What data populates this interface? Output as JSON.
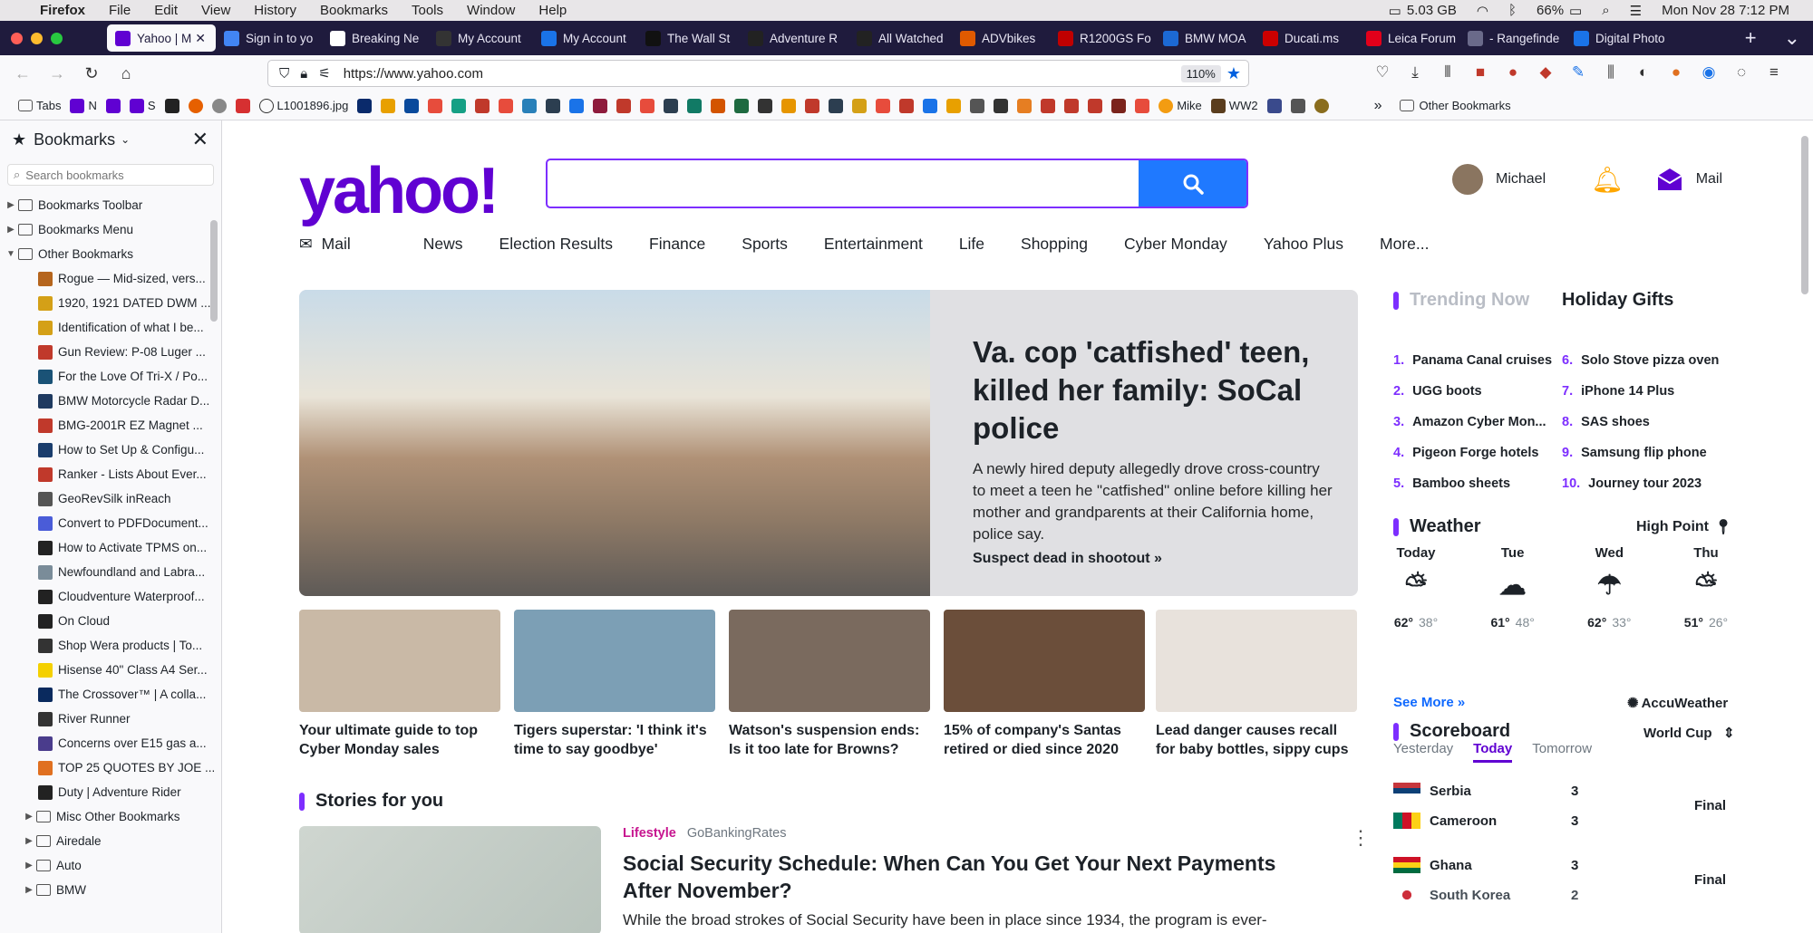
{
  "menubar": {
    "app": "Firefox",
    "items": [
      "File",
      "Edit",
      "View",
      "History",
      "Bookmarks",
      "Tools",
      "Window",
      "Help"
    ],
    "memory": "5.03 GB",
    "battery": "66%",
    "datetime": "Mon Nov 28  7:12 PM"
  },
  "tabs": [
    {
      "label": "Yahoo | M",
      "color": "#6001d2"
    },
    {
      "label": "Sign in to yo",
      "color": "#4285f4"
    },
    {
      "label": "Breaking Ne",
      "color": "#ffffff"
    },
    {
      "label": "My Account",
      "color": "#333333"
    },
    {
      "label": "My Account",
      "color": "#1a73e8"
    },
    {
      "label": "The Wall St",
      "color": "#111111"
    },
    {
      "label": "Adventure R",
      "color": "#222222"
    },
    {
      "label": "All Watched",
      "color": "#222222"
    },
    {
      "label": "ADVbikes",
      "color": "#e05a00"
    },
    {
      "label": "R1200GS Fo",
      "color": "#c00000"
    },
    {
      "label": "BMW MOA",
      "color": "#1c69d4"
    },
    {
      "label": "Ducati.ms",
      "color": "#cc0000"
    },
    {
      "label": "Leica Forum",
      "color": "#e2001a"
    },
    {
      "label": "- Rangefinde",
      "color": "#6a6a8a"
    },
    {
      "label": "Digital Photo",
      "color": "#1a73e8"
    }
  ],
  "navbar": {
    "url": "https://www.yahoo.com",
    "zoom": "110%"
  },
  "bookmarks_bar": {
    "items": [
      "Tabs",
      "N",
      "S",
      "L1001896.jpg",
      "Mike",
      "WW2"
    ],
    "overflow_label": "Other Bookmarks"
  },
  "sidebar": {
    "title": "Bookmarks",
    "search_placeholder": "Search bookmarks",
    "top_folders": [
      "Bookmarks Toolbar",
      "Bookmarks Menu",
      "Other Bookmarks"
    ],
    "items": [
      {
        "label": "Rogue — Mid-sized, vers...",
        "color": "#b5651d"
      },
      {
        "label": "1920, 1921 DATED DWM ...",
        "color": "#d4a017"
      },
      {
        "label": "Identification of what I be...",
        "color": "#d4a017"
      },
      {
        "label": "Gun Review: P-08 Luger ...",
        "color": "#c0392b"
      },
      {
        "label": "For the Love Of Tri-X / Po...",
        "color": "#1a5276"
      },
      {
        "label": "BMW Motorcycle Radar D...",
        "color": "#1f3a60"
      },
      {
        "label": "BMG-2001R EZ Magnet ...",
        "color": "#c0392b"
      },
      {
        "label": "How to Set Up & Configu...",
        "color": "#1a3d6d"
      },
      {
        "label": "Ranker - Lists About Ever...",
        "color": "#c0392b"
      },
      {
        "label": "GeoRevSilk inReach",
        "color": "#555555"
      },
      {
        "label": "Convert to PDFDocument...",
        "color": "#4a5cd8"
      },
      {
        "label": "How to Activate TPMS on...",
        "color": "#222222"
      },
      {
        "label": "Newfoundland and Labra...",
        "color": "#7a8c99"
      },
      {
        "label": "Cloudventure Waterproof...",
        "color": "#222222"
      },
      {
        "label": "On Cloud",
        "color": "#222222"
      },
      {
        "label": "Shop Wera products | To...",
        "color": "#333333"
      },
      {
        "label": "Hisense 40\" Class A4 Ser...",
        "color": "#f4d000"
      },
      {
        "label": "The Crossover™ | A colla...",
        "color": "#0a2a5e"
      },
      {
        "label": "River Runner",
        "color": "#333333"
      },
      {
        "label": "Concerns over E15 gas a...",
        "color": "#4a3c8c"
      },
      {
        "label": "TOP 25 QUOTES BY JOE ...",
        "color": "#e07020"
      },
      {
        "label": "Duty | Adventure Rider",
        "color": "#222222"
      }
    ],
    "sub_folders": [
      "Misc Other Bookmarks",
      "Airedale",
      "Auto",
      "BMW"
    ]
  },
  "yahoo": {
    "logo": "yahoo!",
    "user": "Michael",
    "mail_label": "Mail",
    "nav": [
      "Mail",
      "News",
      "Election Results",
      "Finance",
      "Sports",
      "Entertainment",
      "Life",
      "Shopping",
      "Cyber Monday",
      "Yahoo Plus",
      "More..."
    ],
    "hero": {
      "title": "Va. cop 'catfished' teen, killed her family: SoCal police",
      "summary": "A newly hired deputy allegedly drove cross-country to meet a teen he \"catfished\" online before killing her mother and grandparents at their California home, police say.",
      "cta": "Suspect dead in shootout »"
    },
    "cards": [
      {
        "title": "Your ultimate guide to top Cyber Monday sales",
        "color": "#c9b9a6"
      },
      {
        "title": "Tigers superstar: 'I think it's time to say goodbye'",
        "color": "#7c9fb5"
      },
      {
        "title": "Watson's suspension ends: Is it too late for Browns?",
        "color": "#7a6a5e"
      },
      {
        "title": "15% of company's Santas retired or died since 2020",
        "color": "#6b4e3a"
      },
      {
        "title": "Lead danger causes recall for baby bottles, sippy cups",
        "color": "#e8e2dc"
      }
    ],
    "stories_heading": "Stories for you",
    "story": {
      "category": "Lifestyle",
      "source": "GoBankingRates",
      "title": "Social Security Schedule: When Can You Get Your Next Payments After November?",
      "summary": "While the broad strokes of Social Security have been in place since 1934, the program is ever-"
    },
    "trending": {
      "heading": "Trending Now",
      "gifts_heading": "Holiday Gifts",
      "left": [
        "Panama Canal cruises",
        "UGG boots",
        "Amazon Cyber Mon...",
        "Pigeon Forge hotels",
        "Bamboo sheets"
      ],
      "right": [
        "Solo Stove pizza oven",
        "iPhone 14 Plus",
        "SAS shoes",
        "Samsung flip phone",
        "Journey tour 2023"
      ]
    },
    "weather": {
      "heading": "Weather",
      "location": "High Point",
      "days": [
        {
          "day": "Today",
          "high": "62°",
          "low": "38°",
          "icon": "partly-cloudy-icon"
        },
        {
          "day": "Tue",
          "high": "61°",
          "low": "48°",
          "icon": "cloud-icon"
        },
        {
          "day": "Wed",
          "high": "62°",
          "low": "33°",
          "icon": "rain-icon"
        },
        {
          "day": "Thu",
          "high": "51°",
          "low": "26°",
          "icon": "partly-cloudy-icon"
        }
      ],
      "see_more": "See More »",
      "provider": "AccuWeather"
    },
    "scoreboard": {
      "heading": "Scoreboard",
      "league": "World Cup",
      "tabs": [
        "Yesterday",
        "Today",
        "Tomorrow"
      ],
      "games": [
        {
          "home": "Serbia",
          "home_score": "3",
          "away": "Cameroon",
          "away_score": "3",
          "status": "Final"
        },
        {
          "home": "Ghana",
          "home_score": "3",
          "away": "South Korea",
          "away_score": "2",
          "status": "Final"
        }
      ]
    }
  }
}
